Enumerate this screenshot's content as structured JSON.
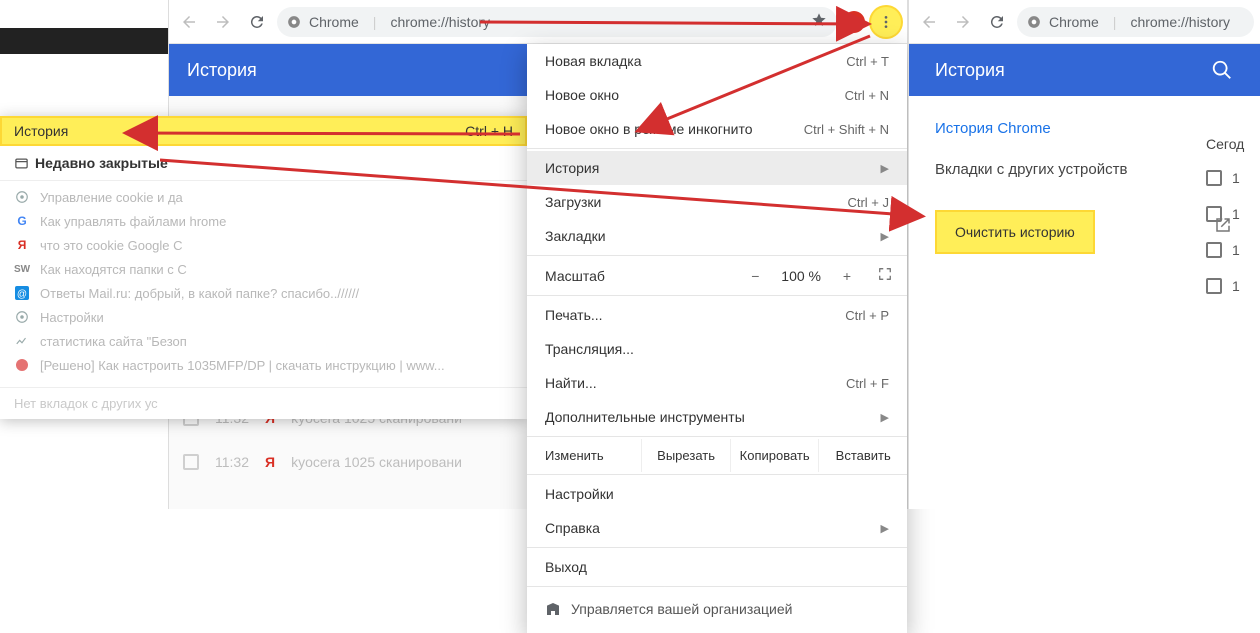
{
  "omnibox": {
    "secure": "Chrome",
    "url": "chrome://history"
  },
  "bluebar_title": "История",
  "submenu": {
    "history_label": "История",
    "history_shortcut": "Ctrl + H",
    "recent_header": "Недавно закрытые",
    "items": [
      "Управление cookie и да",
      "Как управлять файлами hrome",
      "что это cookie Google C",
      "Как находятся папки с C",
      "Ответы Mail.ru: добрый, в какой папке? спасибо..//////",
      "Настройки",
      "статистика сайта \"Безоп",
      "[Решено] Как настроить 1035MFP/DP | скачать инструкцию | www..."
    ],
    "footer": "Нет вкладок с других ус"
  },
  "menu": {
    "new_tab": "Новая вкладка",
    "new_tab_sc": "Ctrl + T",
    "new_window": "Новое окно",
    "new_window_sc": "Ctrl + N",
    "incognito": "Новое окно в режиме инкогнито",
    "incognito_sc": "Ctrl + Shift + N",
    "history": "История",
    "downloads": "Загрузки",
    "downloads_sc": "Ctrl + J",
    "bookmarks": "Закладки",
    "zoom": "Масштаб",
    "zoom_val": "100 %",
    "print": "Печать...",
    "print_sc": "Ctrl + P",
    "cast": "Трансляция...",
    "find": "Найти...",
    "find_sc": "Ctrl + F",
    "more_tools": "Дополнительные инструменты",
    "edit_label": "Изменить",
    "cut": "Вырезать",
    "copy": "Копировать",
    "paste": "Вставить",
    "settings": "Настройки",
    "help": "Справка",
    "exit": "Выход",
    "managed": "Управляется вашей организацией"
  },
  "win1_history": {
    "rows": [
      {
        "time": "11:32",
        "title": "kyocera 1025 сканировани"
      },
      {
        "time": "11:32",
        "title": "kyocera 1025 сканировани"
      }
    ]
  },
  "win2": {
    "nav_history": "История Chrome",
    "nav_tabs": "Вкладки с других устройств",
    "clear": "Очистить историю",
    "day": "Сегод",
    "times": [
      "1",
      "1",
      "1",
      "1"
    ]
  }
}
